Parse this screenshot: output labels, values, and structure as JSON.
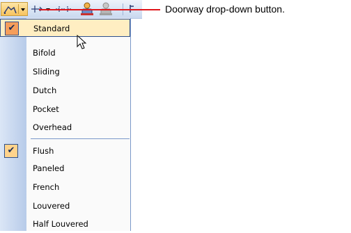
{
  "callout": {
    "text": "Doorway drop-down button."
  },
  "toolbar": {
    "buttons": [
      {
        "name": "doorway",
        "icon": "doorway-icon"
      },
      {
        "name": "window",
        "icon": "window-icon"
      },
      {
        "name": "opening",
        "icon": "opening-icon"
      },
      {
        "name": "person",
        "icon": "person-icon"
      },
      {
        "name": "person-gray",
        "icon": "person-icon"
      }
    ]
  },
  "menu": {
    "items": [
      {
        "label": "Standard",
        "checked": true,
        "highlighted": true
      },
      {
        "label": "Bifold",
        "checked": false
      },
      {
        "label": "Sliding",
        "checked": false
      },
      {
        "label": "Dutch",
        "checked": false
      },
      {
        "label": "Pocket",
        "checked": false
      },
      {
        "label": "Overhead",
        "checked": false
      },
      {
        "label": "Flush",
        "checked": true
      },
      {
        "label": "Paneled",
        "checked": false
      },
      {
        "label": "French",
        "checked": false
      },
      {
        "label": "Louvered",
        "checked": false
      },
      {
        "label": "Half Louvered",
        "checked": false
      }
    ]
  },
  "colors": {
    "callout_line": "#e0161b",
    "highlight": "#ffeec2",
    "check_active": "#f59e5b",
    "check_normal": "#ffd38c"
  }
}
